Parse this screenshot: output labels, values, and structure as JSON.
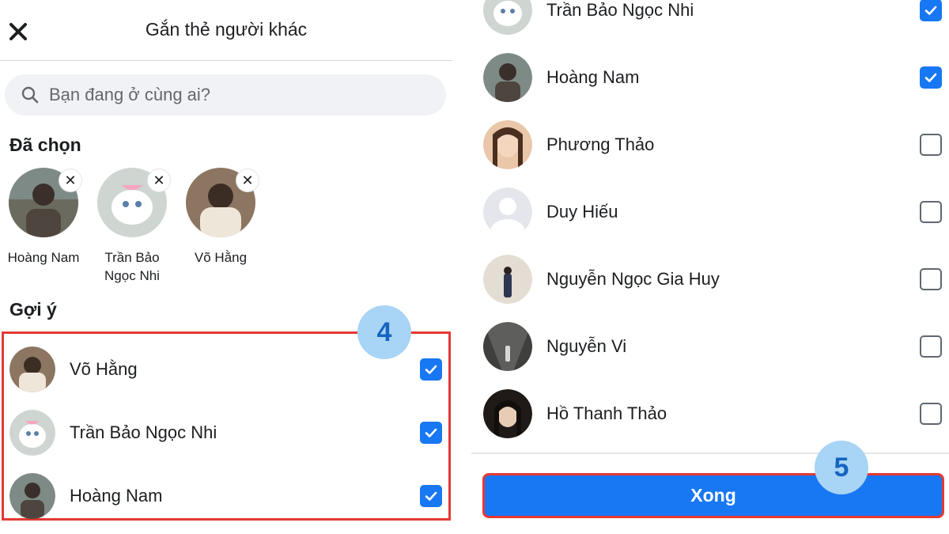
{
  "header": {
    "title": "Gắn thẻ người khác",
    "close_icon": "close-icon"
  },
  "search": {
    "placeholder": "Bạn đang ở cùng ai?",
    "icon": "search-icon"
  },
  "selected": {
    "title": "Đã chọn",
    "items": [
      {
        "name": "Hoàng Nam",
        "avatar_color": "#6b6a5e"
      },
      {
        "name": "Trần Bảo Ngọc Nhi",
        "avatar_color": "#cfd6d2"
      },
      {
        "name": "Võ Hằng",
        "avatar_color": "#b79d86"
      }
    ]
  },
  "suggestions": {
    "title": "Gợi ý",
    "items": [
      {
        "name": "Võ Hằng",
        "checked": true
      },
      {
        "name": "Trần Bảo Ngọc Nhi",
        "checked": true
      },
      {
        "name": "Hoàng Nam",
        "checked": true
      }
    ]
  },
  "friend_list": {
    "items": [
      {
        "name": "Trần Bảo Ngọc Nhi",
        "checked": true
      },
      {
        "name": "Hoàng Nam",
        "checked": true
      },
      {
        "name": "Phương Thảo",
        "checked": false
      },
      {
        "name": "Duy Hiếu",
        "checked": false
      },
      {
        "name": "Nguyễn Ngọc Gia Huy",
        "checked": false
      },
      {
        "name": "Nguyễn Vi",
        "checked": false
      },
      {
        "name": "Hồ Thanh Thảo",
        "checked": false
      }
    ]
  },
  "footer": {
    "done_label": "Xong"
  },
  "steps": {
    "step4": "4",
    "step5": "5"
  },
  "colors": {
    "accent": "#1877f2",
    "highlight_border": "#e53935",
    "step_badge_bg": "#a8d4f5",
    "step_badge_text": "#1565c0"
  }
}
